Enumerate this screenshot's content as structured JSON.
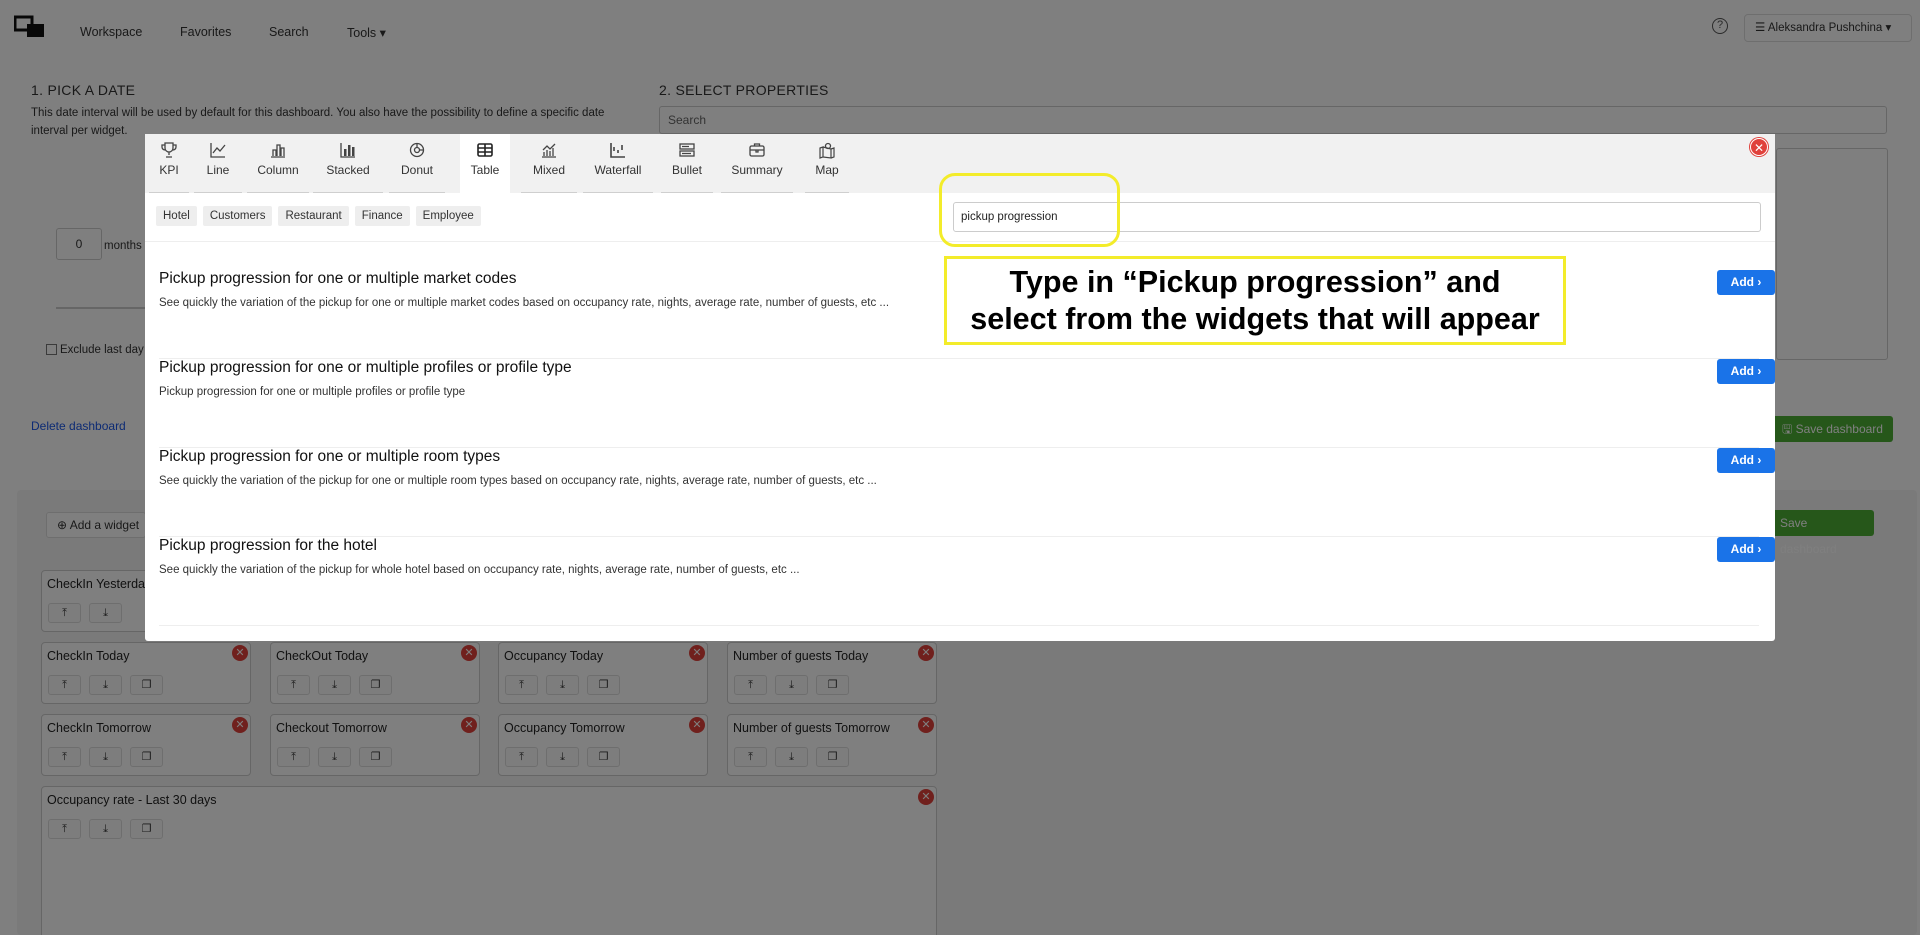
{
  "nav": {
    "items": [
      "Workspace",
      "Favorites",
      "Search",
      "Tools ▾"
    ],
    "user": "☰  Aleksandra Pushchina ▾"
  },
  "section1": {
    "title": "1. PICK A DATE",
    "description": "This date interval will be used by default for this dashboard. You also have the possibility to define a specific date interval per widget.",
    "months_value": "0",
    "months_label": "months (",
    "exclude_label": "Exclude last day",
    "delete_label": "Delete dashboard"
  },
  "section2": {
    "title": "2. SELECT PROPERTIES",
    "search_placeholder": "Search"
  },
  "save_label": "Save dashboard",
  "add_widget_label": "Add a widget",
  "widgets": [
    {
      "title": "CheckIn Yesterday"
    },
    {
      "title": "CheckIn Today"
    },
    {
      "title": "CheckOut Today"
    },
    {
      "title": "Occupancy Today"
    },
    {
      "title": "Number of guests Today"
    },
    {
      "title": "CheckIn Tomorrow"
    },
    {
      "title": "Checkout Tomorrow"
    },
    {
      "title": "Occupancy Tomorrow"
    },
    {
      "title": "Number of guests Tomorrow"
    },
    {
      "title": "Occupancy rate - Last 30 days"
    }
  ],
  "modal": {
    "tabs": [
      "KPI",
      "Line",
      "Column",
      "Stacked",
      "Donut",
      "Table",
      "Mixed",
      "Waterfall",
      "Bullet",
      "Summary",
      "Map"
    ],
    "active_tab": "Table",
    "chips": [
      "Hotel",
      "Customers",
      "Restaurant",
      "Finance",
      "Employee"
    ],
    "search_value": "pickup progression",
    "add_label": "Add",
    "results": [
      {
        "title": "Pickup progression for one or multiple market codes",
        "desc": "See quickly the variation of the pickup for one or multiple market codes based on occupancy rate, nights, average rate, number of guests, etc ..."
      },
      {
        "title": "Pickup progression for one or multiple profiles or profile type",
        "desc": "Pickup progression for one or multiple profiles or profile type"
      },
      {
        "title": "Pickup progression for one or multiple room types",
        "desc": "See quickly the variation of the pickup for one or multiple room types based on occupancy rate, nights, average rate, number of guests, etc ..."
      },
      {
        "title": "Pickup progression for the hotel",
        "desc": "See quickly the variation of the pickup for whole hotel based on occupancy rate, nights, average rate, number of guests, etc ..."
      }
    ]
  },
  "annotation": {
    "line1": "Type in “Pickup progression” and",
    "line2": "select from the widgets that will appear"
  },
  "colors": {
    "accent": "#1a73e8",
    "save": "#4caf35",
    "close": "#e0413b",
    "highlight": "#f3ec2a"
  }
}
